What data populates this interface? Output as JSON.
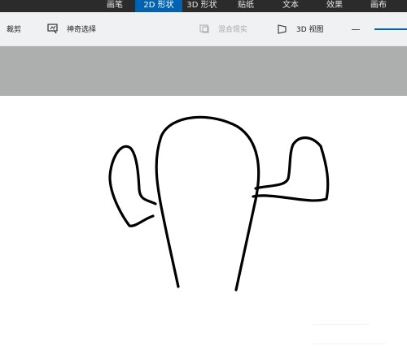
{
  "menu": {
    "items": [
      {
        "label": "画笔"
      },
      {
        "label": "2D 形状"
      },
      {
        "label": "3D 形状"
      },
      {
        "label": "贴纸"
      },
      {
        "label": "文本"
      },
      {
        "label": "效果"
      },
      {
        "label": "画布"
      }
    ],
    "active_index": 1
  },
  "toolbar": {
    "crop_label": "裁剪",
    "magic_select_label": "神奇选择",
    "mixed_reality_label": "混合现实",
    "view_3d_label": "3D 视图"
  },
  "colors": {
    "menubar_bg": "#2b2b2b",
    "accent": "#0063b1",
    "toolbar_bg": "#f0f1f2",
    "band_bg": "#adaeae",
    "canvas_bg": "#ffffff",
    "stroke": "#000000"
  },
  "icons": {
    "magic_select": "magic-select-icon",
    "mixed_reality": "mixed-reality-icon",
    "view_3d": "view-3d-icon",
    "zoom_out": "minus-icon"
  }
}
